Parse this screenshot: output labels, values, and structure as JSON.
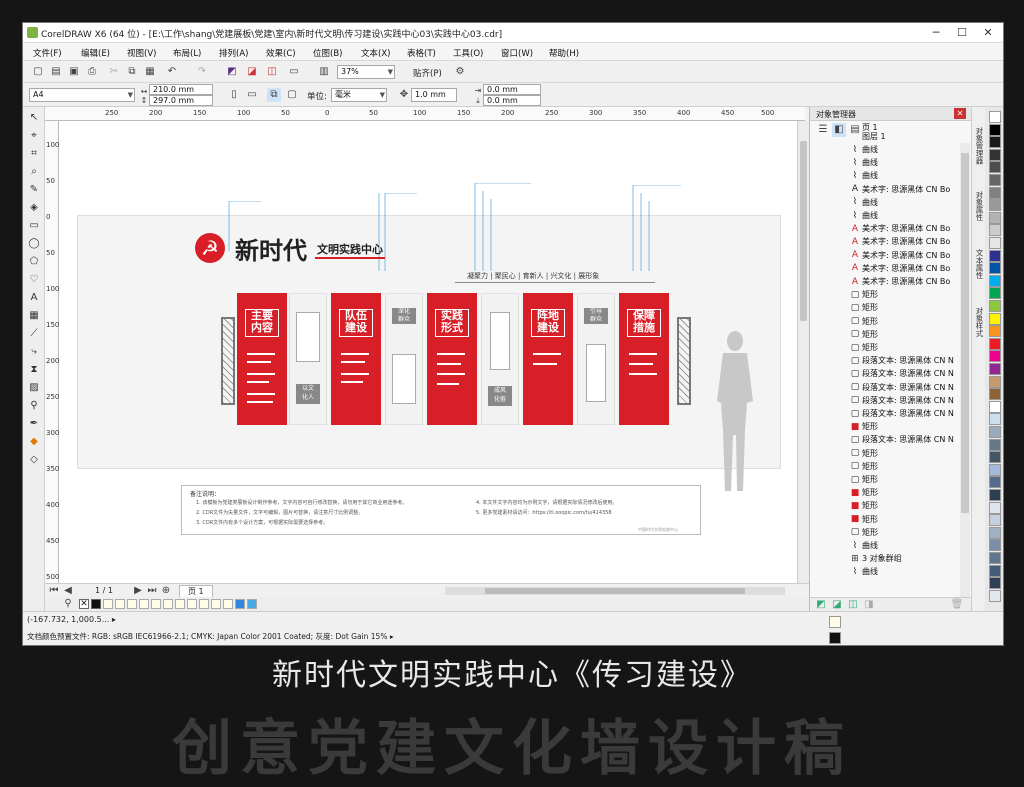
{
  "window": {
    "title": "CorelDRAW X6 (64 位) - [E:\\工作\\shang\\党建展板\\党建\\室内\\新时代文明\\传习建设\\实践中心03\\实践中心03.cdr]",
    "controls": [
      "─",
      "☐",
      "✕"
    ]
  },
  "menu": [
    "文件(F)",
    "编辑(E)",
    "视图(V)",
    "布局(L)",
    "排列(A)",
    "效果(C)",
    "位图(B)",
    "文本(X)",
    "表格(T)",
    "工具(O)",
    "窗口(W)",
    "帮助(H)"
  ],
  "toolbar": {
    "zoom": "37%",
    "snap": "贴齐(P)"
  },
  "propertybar": {
    "page_size": "A4",
    "width": "210.0 mm",
    "height": "297.0 mm",
    "units_label": "单位:",
    "units": "毫米",
    "nudge": "1.0 mm",
    "dup_x": "0.0 mm",
    "dup_y": "0.0 mm"
  },
  "rulers": {
    "h": [
      "250",
      "200",
      "150",
      "100",
      "50",
      "0",
      "50",
      "100",
      "150",
      "200",
      "250",
      "300",
      "350",
      "400",
      "450",
      "500",
      "550"
    ],
    "v": [
      "100",
      "50",
      "0",
      "50",
      "100",
      "150",
      "200",
      "250",
      "300",
      "350",
      "400",
      "450",
      "500"
    ]
  },
  "artwork": {
    "logo_title": "新时代",
    "logo_subtitle": "文明实践中心",
    "nav": "凝聚力 | 聚民心 | 育新人 | 兴文化 | 展形象",
    "panels": [
      {
        "title": "主要\n内容",
        "color": "#d81e26"
      },
      {
        "title": "队伍\n建设",
        "color": "#d81e26"
      },
      {
        "title": "实践\n形式",
        "color": "#d81e26"
      },
      {
        "title": "阵地\n建设",
        "color": "#d81e26"
      },
      {
        "title": "保障\n措施",
        "color": "#d81e26"
      }
    ],
    "small_labels": [
      "深化\n群众",
      "以文\n化人",
      "成风\n化俗",
      "引导\n群众"
    ],
    "notes_title": "备注说明：",
    "notes_left": [
      "1. 该模板为党建类展板设计制作参考，文字内容可自行修改替换，请勿用于其它商业用途参考。",
      "2. CDR文件为矢量文件，文字可编辑，图片可替换，请注意尺寸比例调整。",
      "3. CDR文件内有多个设计方案，可根据实际需要选择参考。"
    ],
    "notes_right": [
      "4. 本文件文字内容均为示例文字，请根据实际情况修改后使用。",
      "5. 更多党建素材请访问：https://ti.ooopic.com/tu/414358"
    ],
    "notes_footer": "中国时代文明实践中心"
  },
  "pagebar": {
    "counter": "1 / 1",
    "page_tab": "页 1"
  },
  "status": {
    "coords": "(-167.732, 1,000.5... ▸",
    "color_profile": "文档颜色预置文件: RGB: sRGB IEC61966-2.1; CMYK: Japan Color 2001 Coated; 灰度: Dot Gain 15% ▸"
  },
  "docker": {
    "title": "对象管理器",
    "page": "页 1",
    "layer": "图层 1",
    "objects": [
      {
        "icon": "curve",
        "label": "曲线"
      },
      {
        "icon": "curve",
        "label": "曲线"
      },
      {
        "icon": "curve",
        "label": "曲线"
      },
      {
        "icon": "artistic-text",
        "label": "美术字: 思源黑体 CN Bo"
      },
      {
        "icon": "curve",
        "label": "曲线"
      },
      {
        "icon": "curve",
        "label": "曲线"
      },
      {
        "icon": "artistic-text-red",
        "label": "美术字: 思源黑体 CN Bo"
      },
      {
        "icon": "artistic-text-red",
        "label": "美术字: 思源黑体 CN Bo"
      },
      {
        "icon": "artistic-text-red",
        "label": "美术字: 思源黑体 CN Bo"
      },
      {
        "icon": "artistic-text-red",
        "label": "美术字: 思源黑体 CN Bo"
      },
      {
        "icon": "artistic-text-red",
        "label": "美术字: 思源黑体 CN Bo"
      },
      {
        "icon": "rect",
        "label": "矩形"
      },
      {
        "icon": "rect",
        "label": "矩形"
      },
      {
        "icon": "rect",
        "label": "矩形"
      },
      {
        "icon": "rect",
        "label": "矩形"
      },
      {
        "icon": "rect",
        "label": "矩形"
      },
      {
        "icon": "para",
        "label": "段落文本: 思源黑体 CN N"
      },
      {
        "icon": "para",
        "label": "段落文本: 思源黑体 CN N"
      },
      {
        "icon": "para",
        "label": "段落文本: 思源黑体 CN N"
      },
      {
        "icon": "para",
        "label": "段落文本: 思源黑体 CN N"
      },
      {
        "icon": "para",
        "label": "段落文本: 思源黑体 CN N"
      },
      {
        "icon": "rect-red",
        "label": "矩形"
      },
      {
        "icon": "para",
        "label": "段落文本: 思源黑体 CN N"
      },
      {
        "icon": "rect",
        "label": "矩形"
      },
      {
        "icon": "rect",
        "label": "矩形"
      },
      {
        "icon": "rect",
        "label": "矩形"
      },
      {
        "icon": "rect-red",
        "label": "矩形"
      },
      {
        "icon": "rect-red",
        "label": "矩形"
      },
      {
        "icon": "rect-red",
        "label": "矩形"
      },
      {
        "icon": "rect",
        "label": "矩形"
      },
      {
        "icon": "curve",
        "label": "曲线"
      },
      {
        "icon": "group",
        "label": "3 对象群组"
      },
      {
        "icon": "curve",
        "label": "曲线"
      }
    ]
  },
  "docker_tabs": [
    "对象管理器",
    "对象属性",
    "文本属性",
    "对象样式"
  ],
  "palette": [
    "#ffffff",
    "#000000",
    "#1a1a1a",
    "#333333",
    "#4d4d4d",
    "#666666",
    "#808080",
    "#999999",
    "#b3b3b3",
    "#cccccc",
    "#e6e6e6",
    "#2e3192",
    "#0054a6",
    "#00aeef",
    "#00a651",
    "#8dc63f",
    "#fff200",
    "#f7941d",
    "#ed1c24",
    "#ec008c",
    "#92278f",
    "#c69c6d",
    "#8c6239",
    "#ffffff",
    "#ccddee",
    "#99aabb",
    "#667788",
    "#445566",
    "#a3b9d9",
    "#556b8d",
    "#2d3e50",
    "#dde5ee",
    "#c4d0de",
    "#9fb0c4",
    "#7a8ea8",
    "#5f7590",
    "#455c78",
    "#303f55",
    "#e0e8f0"
  ],
  "caption": {
    "line1": "新时代文明实践中心《传习建设》",
    "line2": "创意党建文化墙设计稿"
  }
}
